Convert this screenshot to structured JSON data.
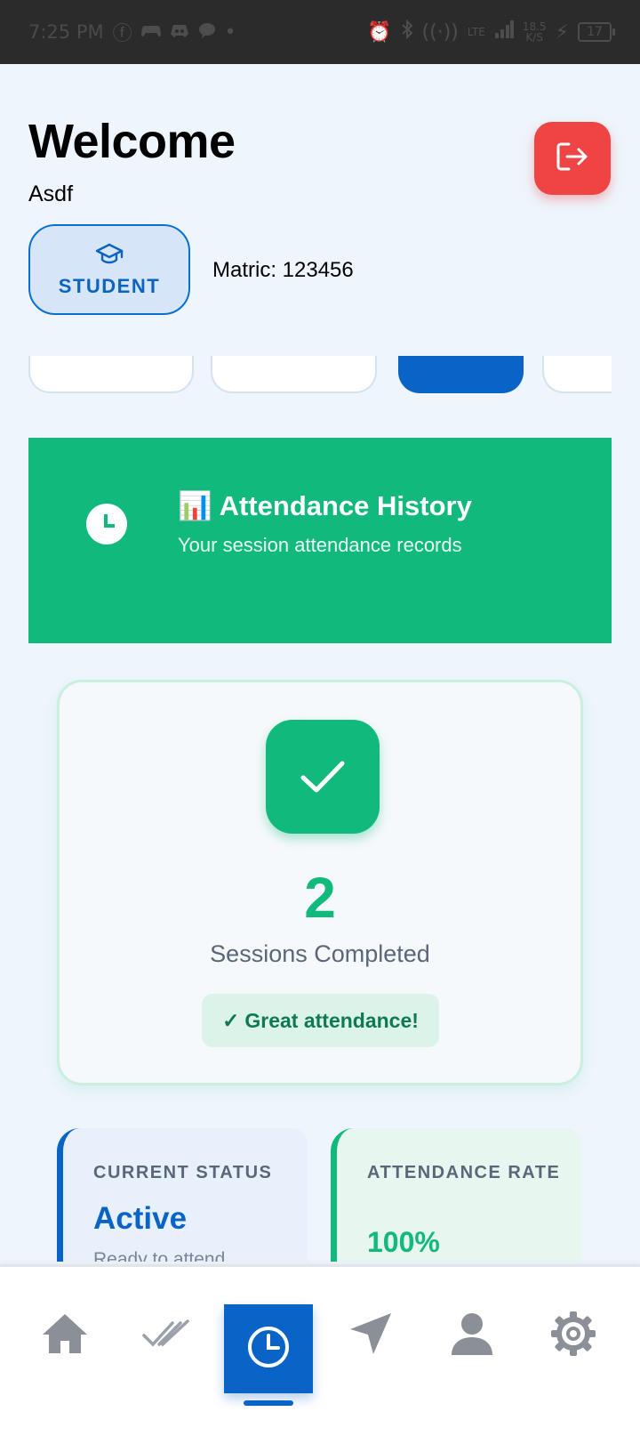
{
  "status_bar": {
    "time": "7:25 PM",
    "network_label": "LTE",
    "speed_value": "18.5",
    "speed_unit": "K/S",
    "battery": "17"
  },
  "header": {
    "title": "Welcome",
    "user_name": "Asdf",
    "role": "STUDENT",
    "matric": "Matric: 123456",
    "logout_icon": "logout-icon"
  },
  "hero": {
    "emoji": "📊",
    "title": "Attendance History",
    "subtitle": "Your session attendance records"
  },
  "summary": {
    "count": "2",
    "label": "Sessions Completed",
    "praise_mark": "✓",
    "praise": "Great attendance!"
  },
  "status_card": {
    "title": "CURRENT STATUS",
    "value": "Active",
    "sub": "Ready to attend"
  },
  "rate_card": {
    "title": "ATTENDANCE RATE",
    "value": "100%"
  },
  "nav": {
    "items": [
      "home-icon",
      "double-check-icon",
      "clock-icon",
      "navigation-arrow-icon",
      "user-icon",
      "settings-gear-icon"
    ],
    "active": "clock-icon"
  },
  "colors": {
    "primary": "#0a64c8",
    "success": "#11b97c",
    "danger": "#ef4444",
    "background": "#eef5fc"
  }
}
